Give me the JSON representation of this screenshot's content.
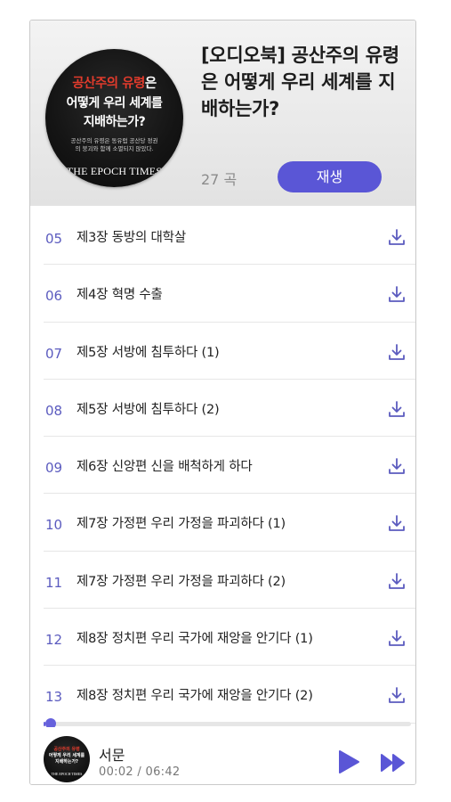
{
  "album": {
    "cover": {
      "line1_red": "공산주의 유령",
      "line1_white": "은",
      "line2": "어떻게 우리 세계를",
      "line3": "지배하는가?",
      "subtitle": "공산주의 유령은 동유럽 공산당 정권의 붕괴와 함께 소멸되지 않았다.",
      "brand": "THE EPOCH TIMES"
    },
    "title": "[오디오북] 공산주의 유령은 어떻게 우리 세계를 지배하는가?",
    "count": "27 곡",
    "play_label": "재생"
  },
  "tracks": [
    {
      "num": "05",
      "title": "제3장 동방의 대학살"
    },
    {
      "num": "06",
      "title": "제4장 혁명 수출"
    },
    {
      "num": "07",
      "title": "제5장 서방에 침투하다 (1)"
    },
    {
      "num": "08",
      "title": "제5장 서방에 침투하다 (2)"
    },
    {
      "num": "09",
      "title": "제6장 신앙편 신을 배척하게 하다"
    },
    {
      "num": "10",
      "title": "제7장 가정편 우리 가정을 파괴하다 (1)"
    },
    {
      "num": "11",
      "title": "제7장 가정편 우리 가정을 파괴하다 (2)"
    },
    {
      "num": "12",
      "title": "제8장 정치편 우리 국가에 재앙을 안기다 (1)"
    },
    {
      "num": "13",
      "title": "제8장 정치편 우리 국가에 재앙을 안기다 (2)"
    }
  ],
  "player": {
    "title": "서문",
    "time": "00:02 / 06:42",
    "progress": 0.005
  },
  "colors": {
    "accent": "#5a56d6",
    "track_number": "#5b5bbf",
    "header_bg": "#e8e8e8"
  },
  "icons": {
    "download": "download-icon",
    "play": "play-icon",
    "next": "fast-forward-icon"
  }
}
